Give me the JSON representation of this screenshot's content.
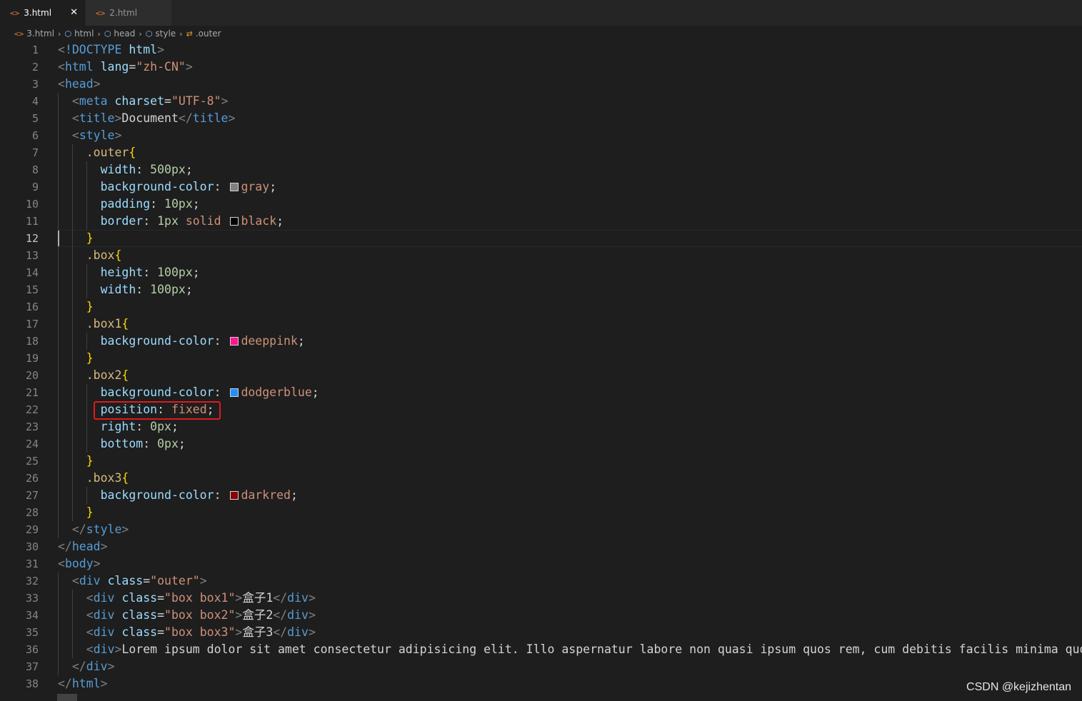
{
  "tabs": [
    {
      "icon": "<>",
      "label": "3.html",
      "active": true,
      "close": "✕"
    },
    {
      "icon": "<>",
      "label": "2.html",
      "active": false
    }
  ],
  "breadcrumb": [
    {
      "icon": "<>",
      "label": "3.html"
    },
    {
      "icon": "⬡",
      "label": "html"
    },
    {
      "icon": "⬡",
      "label": "head"
    },
    {
      "icon": "⬡",
      "label": "style"
    },
    {
      "icon": "⇄",
      "label": ".outer"
    }
  ],
  "editor": {
    "current_line": 12,
    "line_numbers": [
      "1",
      "2",
      "3",
      "4",
      "5",
      "6",
      "7",
      "8",
      "9",
      "10",
      "11",
      "12",
      "13",
      "14",
      "15",
      "16",
      "17",
      "18",
      "19",
      "20",
      "21",
      "22",
      "23",
      "24",
      "25",
      "26",
      "27",
      "28",
      "29",
      "30",
      "31",
      "32",
      "33",
      "34",
      "35",
      "36",
      "37",
      "38"
    ],
    "lines": [
      {
        "indent": "",
        "parts": [
          [
            "p",
            "<"
          ],
          [
            "t",
            "!DOCTYPE"
          ],
          [
            "tx",
            " "
          ],
          [
            "a",
            "html"
          ],
          [
            "p",
            ">"
          ]
        ]
      },
      {
        "indent": "",
        "parts": [
          [
            "p",
            "<"
          ],
          [
            "t",
            "html"
          ],
          [
            "tx",
            " "
          ],
          [
            "a",
            "lang"
          ],
          [
            "tx",
            "="
          ],
          [
            "s",
            "\"zh-CN\""
          ],
          [
            "p",
            ">"
          ]
        ]
      },
      {
        "indent": "",
        "parts": [
          [
            "p",
            "<"
          ],
          [
            "t",
            "head"
          ],
          [
            "p",
            ">"
          ]
        ]
      },
      {
        "indent": "  ",
        "parts": [
          [
            "p",
            "<"
          ],
          [
            "t",
            "meta"
          ],
          [
            "tx",
            " "
          ],
          [
            "a",
            "charset"
          ],
          [
            "tx",
            "="
          ],
          [
            "s",
            "\"UTF-8\""
          ],
          [
            "p",
            ">"
          ]
        ]
      },
      {
        "indent": "  ",
        "parts": [
          [
            "p",
            "<"
          ],
          [
            "t",
            "title"
          ],
          [
            "p",
            ">"
          ],
          [
            "tx",
            "Document"
          ],
          [
            "p",
            "</"
          ],
          [
            "t",
            "title"
          ],
          [
            "p",
            ">"
          ]
        ]
      },
      {
        "indent": "  ",
        "parts": [
          [
            "p",
            "<"
          ],
          [
            "t",
            "style"
          ],
          [
            "p",
            ">"
          ]
        ]
      },
      {
        "indent": "    ",
        "parts": [
          [
            "sel",
            ".outer"
          ],
          [
            "br",
            "{"
          ]
        ]
      },
      {
        "indent": "      ",
        "parts": [
          [
            "a",
            "width"
          ],
          [
            "tx",
            ": "
          ],
          [
            "n",
            "500px"
          ],
          [
            "tx",
            ";"
          ]
        ]
      },
      {
        "indent": "      ",
        "parts": [
          [
            "a",
            "background-color"
          ],
          [
            "tx",
            ": "
          ],
          [
            "swatch",
            "#808080"
          ],
          [
            "s",
            "gray"
          ],
          [
            "tx",
            ";"
          ]
        ]
      },
      {
        "indent": "      ",
        "parts": [
          [
            "a",
            "padding"
          ],
          [
            "tx",
            ": "
          ],
          [
            "n",
            "10px"
          ],
          [
            "tx",
            ";"
          ]
        ]
      },
      {
        "indent": "      ",
        "parts": [
          [
            "a",
            "border"
          ],
          [
            "tx",
            ": "
          ],
          [
            "n",
            "1px"
          ],
          [
            "tx",
            " "
          ],
          [
            "s",
            "solid"
          ],
          [
            "tx",
            " "
          ],
          [
            "swatch",
            "#000000"
          ],
          [
            "s",
            "black"
          ],
          [
            "tx",
            ";"
          ]
        ]
      },
      {
        "indent": "    ",
        "parts": [
          [
            "br",
            "}"
          ]
        ]
      },
      {
        "indent": "    ",
        "parts": [
          [
            "sel",
            ".box"
          ],
          [
            "br",
            "{"
          ]
        ]
      },
      {
        "indent": "      ",
        "parts": [
          [
            "a",
            "height"
          ],
          [
            "tx",
            ": "
          ],
          [
            "n",
            "100px"
          ],
          [
            "tx",
            ";"
          ]
        ]
      },
      {
        "indent": "      ",
        "parts": [
          [
            "a",
            "width"
          ],
          [
            "tx",
            ": "
          ],
          [
            "n",
            "100px"
          ],
          [
            "tx",
            ";"
          ]
        ]
      },
      {
        "indent": "    ",
        "parts": [
          [
            "br",
            "}"
          ]
        ]
      },
      {
        "indent": "    ",
        "parts": [
          [
            "sel",
            ".box1"
          ],
          [
            "br",
            "{"
          ]
        ]
      },
      {
        "indent": "      ",
        "parts": [
          [
            "a",
            "background-color"
          ],
          [
            "tx",
            ": "
          ],
          [
            "swatch",
            "#ff1493"
          ],
          [
            "s",
            "deeppink"
          ],
          [
            "tx",
            ";"
          ]
        ]
      },
      {
        "indent": "    ",
        "parts": [
          [
            "br",
            "}"
          ]
        ]
      },
      {
        "indent": "    ",
        "parts": [
          [
            "sel",
            ".box2"
          ],
          [
            "br",
            "{"
          ]
        ]
      },
      {
        "indent": "      ",
        "parts": [
          [
            "a",
            "background-color"
          ],
          [
            "tx",
            ": "
          ],
          [
            "swatch",
            "#1e90ff"
          ],
          [
            "s",
            "dodgerblue"
          ],
          [
            "tx",
            ";"
          ]
        ]
      },
      {
        "indent": "      ",
        "parts": [
          [
            "a",
            "position"
          ],
          [
            "tx",
            ": "
          ],
          [
            "s",
            "fixed"
          ],
          [
            "tx",
            ";"
          ]
        ]
      },
      {
        "indent": "      ",
        "parts": [
          [
            "a",
            "right"
          ],
          [
            "tx",
            ": "
          ],
          [
            "n",
            "0px"
          ],
          [
            "tx",
            ";"
          ]
        ]
      },
      {
        "indent": "      ",
        "parts": [
          [
            "a",
            "bottom"
          ],
          [
            "tx",
            ": "
          ],
          [
            "n",
            "0px"
          ],
          [
            "tx",
            ";"
          ]
        ]
      },
      {
        "indent": "    ",
        "parts": [
          [
            "br",
            "}"
          ]
        ]
      },
      {
        "indent": "    ",
        "parts": [
          [
            "sel",
            ".box3"
          ],
          [
            "br",
            "{"
          ]
        ]
      },
      {
        "indent": "      ",
        "parts": [
          [
            "a",
            "background-color"
          ],
          [
            "tx",
            ": "
          ],
          [
            "swatch",
            "#8b0000"
          ],
          [
            "s",
            "darkred"
          ],
          [
            "tx",
            ";"
          ]
        ]
      },
      {
        "indent": "    ",
        "parts": [
          [
            "br",
            "}"
          ]
        ]
      },
      {
        "indent": "  ",
        "parts": [
          [
            "p",
            "</"
          ],
          [
            "t",
            "style"
          ],
          [
            "p",
            ">"
          ]
        ]
      },
      {
        "indent": "",
        "parts": [
          [
            "p",
            "</"
          ],
          [
            "t",
            "head"
          ],
          [
            "p",
            ">"
          ]
        ]
      },
      {
        "indent": "",
        "parts": [
          [
            "p",
            "<"
          ],
          [
            "t",
            "body"
          ],
          [
            "p",
            ">"
          ]
        ]
      },
      {
        "indent": "  ",
        "parts": [
          [
            "p",
            "<"
          ],
          [
            "t",
            "div"
          ],
          [
            "tx",
            " "
          ],
          [
            "a",
            "class"
          ],
          [
            "tx",
            "="
          ],
          [
            "s",
            "\"outer\""
          ],
          [
            "p",
            ">"
          ]
        ]
      },
      {
        "indent": "    ",
        "parts": [
          [
            "p",
            "<"
          ],
          [
            "t",
            "div"
          ],
          [
            "tx",
            " "
          ],
          [
            "a",
            "class"
          ],
          [
            "tx",
            "="
          ],
          [
            "s",
            "\"box box1\""
          ],
          [
            "p",
            ">"
          ],
          [
            "tx",
            "盒子1"
          ],
          [
            "p",
            "</"
          ],
          [
            "t",
            "div"
          ],
          [
            "p",
            ">"
          ]
        ]
      },
      {
        "indent": "    ",
        "parts": [
          [
            "p",
            "<"
          ],
          [
            "t",
            "div"
          ],
          [
            "tx",
            " "
          ],
          [
            "a",
            "class"
          ],
          [
            "tx",
            "="
          ],
          [
            "s",
            "\"box box2\""
          ],
          [
            "p",
            ">"
          ],
          [
            "tx",
            "盒子2"
          ],
          [
            "p",
            "</"
          ],
          [
            "t",
            "div"
          ],
          [
            "p",
            ">"
          ]
        ]
      },
      {
        "indent": "    ",
        "parts": [
          [
            "p",
            "<"
          ],
          [
            "t",
            "div"
          ],
          [
            "tx",
            " "
          ],
          [
            "a",
            "class"
          ],
          [
            "tx",
            "="
          ],
          [
            "s",
            "\"box box3\""
          ],
          [
            "p",
            ">"
          ],
          [
            "tx",
            "盒子3"
          ],
          [
            "p",
            "</"
          ],
          [
            "t",
            "div"
          ],
          [
            "p",
            ">"
          ]
        ]
      },
      {
        "indent": "    ",
        "parts": [
          [
            "p",
            "<"
          ],
          [
            "t",
            "div"
          ],
          [
            "p",
            ">"
          ],
          [
            "tx",
            "Lorem ipsum dolor sit amet consectetur adipisicing elit. Illo aspernatur labore non quasi ipsum quos rem, cum debitis facilis minima quo"
          ]
        ]
      },
      {
        "indent": "  ",
        "parts": [
          [
            "p",
            "</"
          ],
          [
            "t",
            "div"
          ],
          [
            "p",
            ">"
          ]
        ]
      },
      {
        "indent": "",
        "parts": [
          [
            "p",
            "</"
          ],
          [
            "t",
            "html"
          ],
          [
            "p",
            ">"
          ]
        ]
      }
    ]
  },
  "watermark": "CSDN @kejizhentan"
}
